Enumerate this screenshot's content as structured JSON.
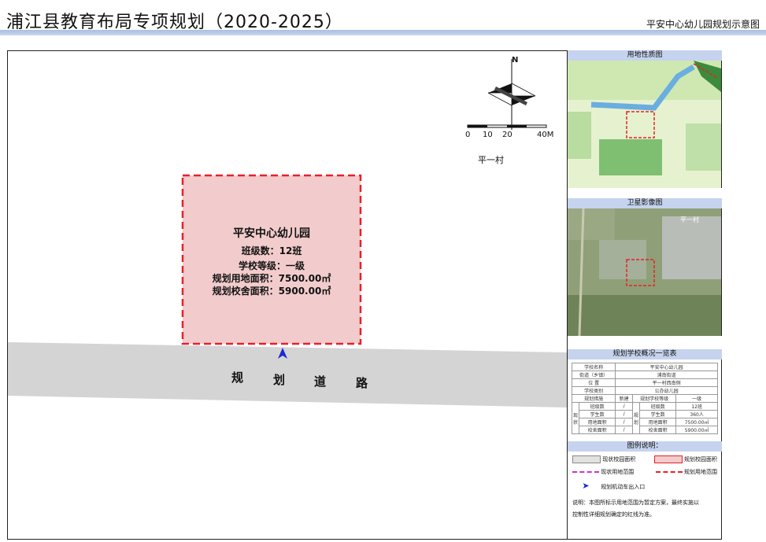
{
  "header": {
    "title": "浦江县教育布局专项规划（2020-2025）",
    "subtitle": "平安中心幼儿园规划示意图"
  },
  "map": {
    "village": "平一村",
    "compass_north": "N",
    "scale": [
      "0",
      "10",
      "20",
      "40M"
    ],
    "road_chars": [
      "规",
      "划",
      "道",
      "路"
    ],
    "school": {
      "name": "平安中心幼儿园",
      "classes": "班级数：12班",
      "grade": "学校等级：一级",
      "land_area": "规划用地面积：7500.00㎡",
      "building_area": "规划校舍面积：5900.00㎡"
    }
  },
  "sidebar": {
    "landuse_title": "用地性质图",
    "satellite_title": "卫星影像图",
    "satellite_village": "平一村",
    "table_title": "规划学校概况一览表",
    "table": {
      "school_name_label": "学校名称",
      "school_name": "平安中心幼儿园",
      "street_label": "街道（乡镇）",
      "street": "浦南街道",
      "location_label": "位      置",
      "location": "平一村西南侧",
      "type_label": "学校类别",
      "type": "公办幼儿园",
      "measure_label": "规划措施",
      "measure": "新建",
      "grade_label": "规划学校等级",
      "grade": "一级",
      "current_label": "现状",
      "plan_label": "规划",
      "rows": [
        {
          "label": "班级数",
          "current": "/",
          "plabel": "班级数",
          "plan": "12班"
        },
        {
          "label": "学生数",
          "current": "/",
          "plabel": "学生数",
          "plan": "360人"
        },
        {
          "label": "用地面积",
          "current": "/",
          "plabel": "用地面积",
          "plan": "7500.00㎡"
        },
        {
          "label": "校舍面积",
          "current": "/",
          "plabel": "校舍面积",
          "plan": "5900.00㎡"
        }
      ]
    },
    "legend": {
      "title": "图例说明：",
      "current_campus": "现状校园面积",
      "planned_campus": "规划校园面积",
      "current_boundary": "现状用地范围",
      "planned_boundary": "规划用地范围",
      "entrance": "规划机动车出入口",
      "note_line1": "说明：本图所标示用地范围为暂定方案，最终实施以",
      "note_line2": "控制性详细规划确定的红线为准。"
    }
  },
  "colors": {
    "school_fill": "#f2cccc",
    "boundary_red": "#e8202a",
    "road": "#d4d4d4",
    "panel_head": "#c5d3ee",
    "current_boundary": "#cc33cc",
    "entrance_arrow": "#1a2ad0"
  }
}
